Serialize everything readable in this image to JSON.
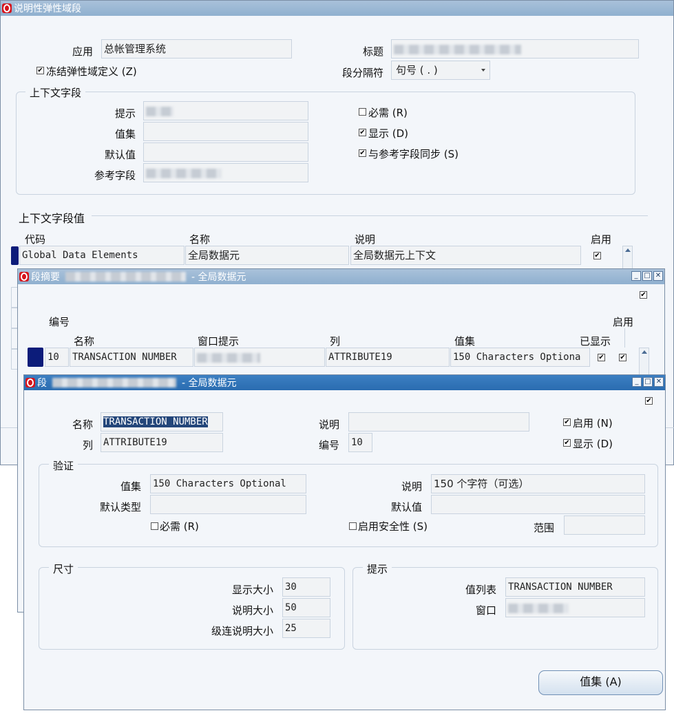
{
  "win1": {
    "title": "说明性弹性域段",
    "app_label": "应用",
    "app_value": "总帐管理系统",
    "title_label": "标题",
    "freeze_label": "冻结弹性域定义 (Z)",
    "freeze_checked": true,
    "separator_label": "段分隔符",
    "separator_value": "句号 ( . )",
    "context_group": "上下文字段",
    "prompt_label": "提示",
    "valueset_label": "值集",
    "default_label": "默认值",
    "ref_label": "参考字段",
    "required_label": "必需 (R)",
    "display_label": "显示 (D)",
    "sync_label": "与参考字段同步 (S)",
    "ctx_values_title": "上下文字段值",
    "col_code": "代码",
    "col_name": "名称",
    "col_desc": "说明",
    "col_enabled": "启用",
    "row_code": "Global Data Elements",
    "row_name": "全局数据元",
    "row_desc": "全局数据元上下文"
  },
  "win2": {
    "title_prefix": "段摘要",
    "title_suffix": "- 全局数据元",
    "col_num": "编号",
    "col_name": "名称",
    "col_prompt": "窗口提示",
    "col_column": "列",
    "col_valueset": "值集",
    "col_displayed": "已显示",
    "col_enabled": "启用",
    "row_num": "10",
    "row_name": "TRANSACTION NUMBER",
    "row_column": "ATTRIBUTE19",
    "row_valueset": "150 Characters Optiona"
  },
  "win3": {
    "title_prefix": "段",
    "title_suffix": "- 全局数据元",
    "name_label": "名称",
    "name_value": "TRANSACTION NUMBER",
    "column_label": "列",
    "column_value": "ATTRIBUTE19",
    "desc_label": "说明",
    "num_label": "编号",
    "num_value": "10",
    "enabled_label": "启用 (N)",
    "display_label": "显示 (D)",
    "validation_group": "验证",
    "valueset_label": "值集",
    "valueset_value": "150 Characters Optional",
    "vs_desc_label": "说明",
    "vs_desc_value": "150 个字符（可选）",
    "default_type_label": "默认类型",
    "default_value_label": "默认值",
    "required_label": "必需 (R)",
    "security_label": "启用安全性 (S)",
    "range_label": "范围",
    "size_group": "尺寸",
    "display_size_label": "显示大小",
    "display_size_value": "30",
    "desc_size_label": "说明大小",
    "desc_size_value": "50",
    "concat_size_label": "级连说明大小",
    "concat_size_value": "25",
    "prompt_group": "提示",
    "list_label": "值列表",
    "list_value": "TRANSACTION NUMBER",
    "window_label": "窗口",
    "valueset_button": "值集 (A)"
  },
  "colors": {
    "active_title": "#2a6cb0",
    "inactive_title": "#8fb0cf",
    "oracle_red": "#d5141c",
    "selection": "#23467a",
    "row_marker": "#0c1c7a"
  }
}
